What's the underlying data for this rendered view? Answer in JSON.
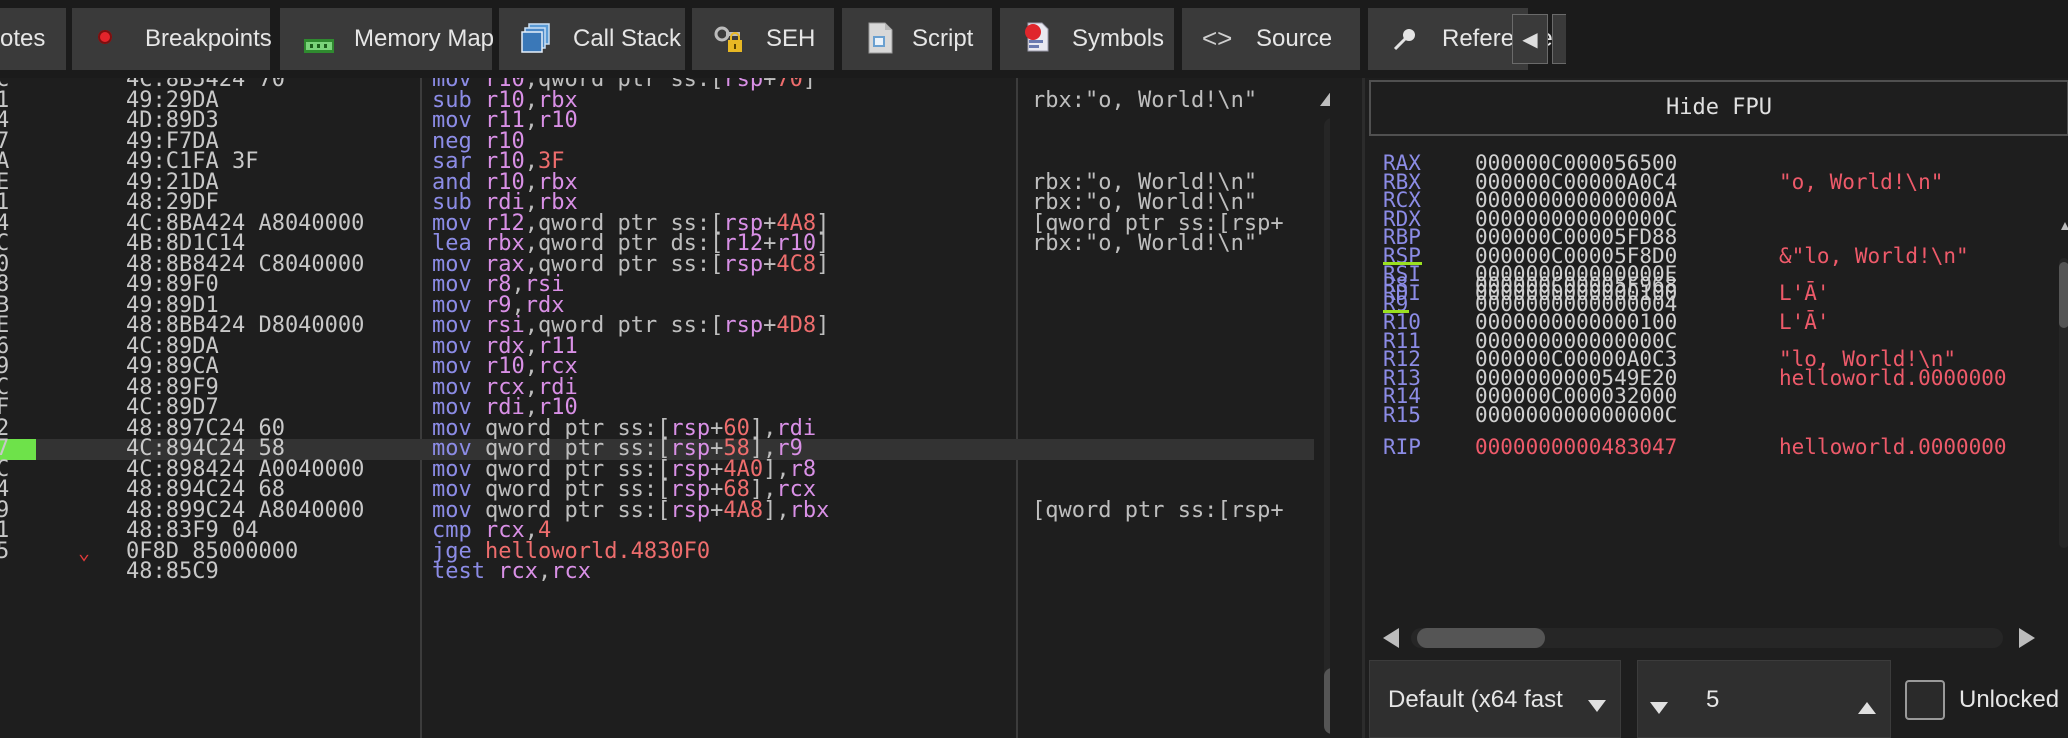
{
  "tabs": [
    {
      "label": "otes",
      "icon": "notes-icon"
    },
    {
      "label": "Breakpoints",
      "icon": "breakpoint-dot-icon"
    },
    {
      "label": "Memory Map",
      "icon": "memory-map-icon"
    },
    {
      "label": "Call Stack",
      "icon": "call-stack-icon"
    },
    {
      "label": "SEH",
      "icon": "seh-key-lock-icon"
    },
    {
      "label": "Script",
      "icon": "script-icon"
    },
    {
      "label": "Symbols",
      "icon": "symbols-icon"
    },
    {
      "label": "Source",
      "icon": "source-code-icon"
    },
    {
      "label": "References",
      "icon": "references-pin-icon"
    }
  ],
  "tab_nav": {
    "left": "◀",
    "right": ""
  },
  "disassembly": {
    "rows": [
      {
        "addr": "C",
        "bytes": "4C:8B5424 70",
        "mn": "mov",
        "ops": [
          [
            "r",
            "r10"
          ],
          [
            "s",
            ","
          ],
          [
            "s",
            "qword ptr "
          ],
          [
            "s",
            "ss:["
          ],
          [
            "r",
            "rsp"
          ],
          [
            "s",
            "+"
          ],
          [
            "n",
            "70"
          ],
          [
            "s",
            "]"
          ]
        ],
        "comment": ""
      },
      {
        "addr": "1",
        "bytes": "49:29DA",
        "mn": "sub",
        "ops": [
          [
            "r",
            "r10"
          ],
          [
            "s",
            ","
          ],
          [
            "r",
            "rbx"
          ]
        ],
        "comment": "rbx:\"o, World!\\n\""
      },
      {
        "addr": "4",
        "bytes": "4D:89D3",
        "mn": "mov",
        "ops": [
          [
            "r",
            "r11"
          ],
          [
            "s",
            ","
          ],
          [
            "r",
            "r10"
          ]
        ],
        "comment": ""
      },
      {
        "addr": "7",
        "bytes": "49:F7DA",
        "mn": "neg",
        "ops": [
          [
            "r",
            "r10"
          ]
        ],
        "comment": ""
      },
      {
        "addr": "A",
        "bytes": "49:C1FA 3F",
        "mn": "sar",
        "ops": [
          [
            "r",
            "r10"
          ],
          [
            "s",
            ","
          ],
          [
            "n",
            "3F"
          ]
        ],
        "comment": ""
      },
      {
        "addr": "E",
        "bytes": "49:21DA",
        "mn": "and",
        "ops": [
          [
            "r",
            "r10"
          ],
          [
            "s",
            ","
          ],
          [
            "r",
            "rbx"
          ]
        ],
        "comment": "rbx:\"o, World!\\n\""
      },
      {
        "addr": "1",
        "bytes": "48:29DF",
        "mn": "sub",
        "ops": [
          [
            "r",
            "rdi"
          ],
          [
            "s",
            ","
          ],
          [
            "r",
            "rbx"
          ]
        ],
        "comment": "rbx:\"o, World!\\n\""
      },
      {
        "addr": "4",
        "bytes": "4C:8BA424 A8040000",
        "mn": "mov",
        "ops": [
          [
            "r",
            "r12"
          ],
          [
            "s",
            ","
          ],
          [
            "s",
            "qword ptr "
          ],
          [
            "s",
            "ss:["
          ],
          [
            "r",
            "rsp"
          ],
          [
            "s",
            "+"
          ],
          [
            "n",
            "4A8"
          ],
          [
            "s",
            "]"
          ]
        ],
        "comment": "[qword ptr ss:[rsp+"
      },
      {
        "addr": "C",
        "bytes": "4B:8D1C14",
        "mn": "lea",
        "ops": [
          [
            "r",
            "rbx"
          ],
          [
            "s",
            ","
          ],
          [
            "s",
            "qword ptr "
          ],
          [
            "s",
            "ds:["
          ],
          [
            "r",
            "r12"
          ],
          [
            "s",
            "+"
          ],
          [
            "r",
            "r10"
          ],
          [
            "s",
            "]"
          ]
        ],
        "comment": "rbx:\"o, World!\\n\""
      },
      {
        "addr": "0",
        "bytes": "48:8B8424 C8040000",
        "mn": "mov",
        "ops": [
          [
            "r",
            "rax"
          ],
          [
            "s",
            ","
          ],
          [
            "s",
            "qword ptr "
          ],
          [
            "s",
            "ss:["
          ],
          [
            "r",
            "rsp"
          ],
          [
            "s",
            "+"
          ],
          [
            "n",
            "4C8"
          ],
          [
            "s",
            "]"
          ]
        ],
        "comment": ""
      },
      {
        "addr": "8",
        "bytes": "49:89F0",
        "mn": "mov",
        "ops": [
          [
            "r",
            "r8"
          ],
          [
            "s",
            ","
          ],
          [
            "r",
            "rsi"
          ]
        ],
        "comment": ""
      },
      {
        "addr": "B",
        "bytes": "49:89D1",
        "mn": "mov",
        "ops": [
          [
            "r",
            "r9"
          ],
          [
            "s",
            ","
          ],
          [
            "r",
            "rdx"
          ]
        ],
        "comment": ""
      },
      {
        "addr": "E",
        "bytes": "48:8BB424 D8040000",
        "mn": "mov",
        "ops": [
          [
            "r",
            "rsi"
          ],
          [
            "s",
            ","
          ],
          [
            "s",
            "qword ptr "
          ],
          [
            "s",
            "ss:["
          ],
          [
            "r",
            "rsp"
          ],
          [
            "s",
            "+"
          ],
          [
            "n",
            "4D8"
          ],
          [
            "s",
            "]"
          ]
        ],
        "comment": ""
      },
      {
        "addr": "6",
        "bytes": "4C:89DA",
        "mn": "mov",
        "ops": [
          [
            "r",
            "rdx"
          ],
          [
            "s",
            ","
          ],
          [
            "r",
            "r11"
          ]
        ],
        "comment": ""
      },
      {
        "addr": "9",
        "bytes": "49:89CA",
        "mn": "mov",
        "ops": [
          [
            "r",
            "r10"
          ],
          [
            "s",
            ","
          ],
          [
            "r",
            "rcx"
          ]
        ],
        "comment": ""
      },
      {
        "addr": "C",
        "bytes": "48:89F9",
        "mn": "mov",
        "ops": [
          [
            "r",
            "rcx"
          ],
          [
            "s",
            ","
          ],
          [
            "r",
            "rdi"
          ]
        ],
        "comment": ""
      },
      {
        "addr": "F",
        "bytes": "4C:89D7",
        "mn": "mov",
        "ops": [
          [
            "r",
            "rdi"
          ],
          [
            "s",
            ","
          ],
          [
            "r",
            "r10"
          ]
        ],
        "comment": ""
      },
      {
        "addr": "2",
        "bytes": "48:897C24 60",
        "mn": "mov",
        "ops": [
          [
            "s",
            "qword ptr "
          ],
          [
            "s",
            "ss:["
          ],
          [
            "r",
            "rsp"
          ],
          [
            "s",
            "+"
          ],
          [
            "n",
            "60"
          ],
          [
            "s",
            "],"
          ],
          [
            "r",
            "rdi"
          ]
        ],
        "comment": ""
      },
      {
        "addr": "7",
        "bytes": "4C:894C24 58",
        "mn": "mov",
        "ops": [
          [
            "s",
            "qword ptr "
          ],
          [
            "s",
            "ss:["
          ],
          [
            "r",
            "rsp"
          ],
          [
            "s",
            "+"
          ],
          [
            "n",
            "58"
          ],
          [
            "s",
            "],"
          ],
          [
            "r",
            "r9"
          ]
        ],
        "comment": "",
        "current": true
      },
      {
        "addr": "C",
        "bytes": "4C:898424 A0040000",
        "mn": "mov",
        "ops": [
          [
            "s",
            "qword ptr "
          ],
          [
            "s",
            "ss:["
          ],
          [
            "r",
            "rsp"
          ],
          [
            "s",
            "+"
          ],
          [
            "n",
            "4A0"
          ],
          [
            "s",
            "],"
          ],
          [
            "r",
            "r8"
          ]
        ],
        "comment": ""
      },
      {
        "addr": "4",
        "bytes": "48:894C24 68",
        "mn": "mov",
        "ops": [
          [
            "s",
            "qword ptr "
          ],
          [
            "s",
            "ss:["
          ],
          [
            "r",
            "rsp"
          ],
          [
            "s",
            "+"
          ],
          [
            "n",
            "68"
          ],
          [
            "s",
            "],"
          ],
          [
            "r",
            "rcx"
          ]
        ],
        "comment": ""
      },
      {
        "addr": "9",
        "bytes": "48:899C24 A8040000",
        "mn": "mov",
        "ops": [
          [
            "s",
            "qword ptr "
          ],
          [
            "s",
            "ss:["
          ],
          [
            "r",
            "rsp"
          ],
          [
            "s",
            "+"
          ],
          [
            "n",
            "4A8"
          ],
          [
            "s",
            "],"
          ],
          [
            "r",
            "rbx"
          ]
        ],
        "comment": "[qword ptr ss:[rsp+"
      },
      {
        "addr": "1",
        "bytes": "48:83F9 04",
        "mn": "cmp",
        "ops": [
          [
            "r",
            "rcx"
          ],
          [
            "s",
            ","
          ],
          [
            "n",
            "4"
          ]
        ],
        "comment": ""
      },
      {
        "addr": "5",
        "bytes": "0F8D 85000000",
        "mn": "jge",
        "ops": [
          [
            "n",
            "helloworld.4830F0"
          ]
        ],
        "comment": "",
        "jump": true
      },
      {
        "addr": "",
        "bytes": "48:85C9",
        "mn": "test",
        "ops": [
          [
            "r",
            "rcx"
          ],
          [
            "s",
            ","
          ],
          [
            "r",
            "rcx"
          ]
        ],
        "comment": ""
      }
    ]
  },
  "registers": {
    "hide_fpu_label": "Hide FPU",
    "groups": [
      [
        {
          "name": "RAX",
          "value": "000000C000056500",
          "comment": ""
        },
        {
          "name": "RBX",
          "value": "000000C00000A0C4",
          "comment": "\"o, World!\\n\""
        },
        {
          "name": "RCX",
          "value": "000000000000000A",
          "comment": ""
        },
        {
          "name": "RDX",
          "value": "000000000000000C",
          "comment": ""
        },
        {
          "name": "RBP",
          "value": "000000C00005FD88",
          "comment": ""
        },
        {
          "name": "RSP",
          "value": "000000C00005F8D0",
          "comment": "&\"lo, World!\\n\"",
          "underline": true
        },
        {
          "name": "RSI",
          "value": "000000000000000E",
          "comment": ""
        },
        {
          "name": "RDI",
          "value": "0000000000000100",
          "comment": "L'Ā'"
        }
      ],
      [
        {
          "name": "R8",
          "value": "000000C00005F968",
          "comment": ""
        },
        {
          "name": "R9",
          "value": "0000000000000004",
          "comment": "",
          "underline": true
        },
        {
          "name": "R10",
          "value": "0000000000000100",
          "comment": "L'Ā'"
        },
        {
          "name": "R11",
          "value": "000000000000000C",
          "comment": ""
        },
        {
          "name": "R12",
          "value": "000000C00000A0C3",
          "comment": "\"lo, World!\\n\""
        },
        {
          "name": "R13",
          "value": "0000000000549E20",
          "comment": "helloworld.0000000"
        },
        {
          "name": "R14",
          "value": "000000C000032000",
          "comment": ""
        },
        {
          "name": "R15",
          "value": "000000000000000C",
          "comment": ""
        }
      ],
      [
        {
          "name": "RIP",
          "value": "0000000000483047",
          "comment": "helloworld.0000000",
          "rip": true
        }
      ]
    ]
  },
  "bottom": {
    "calling_convention": "Default (x64 fast",
    "arg_count": "5",
    "unlocked_label": "Unlocked"
  },
  "colors": {
    "mnemonic": "#8c8ce6",
    "register": "#d990e6",
    "number": "#ee6d6d",
    "current_marker": "#6ee24a",
    "underline": "#9ae020"
  }
}
